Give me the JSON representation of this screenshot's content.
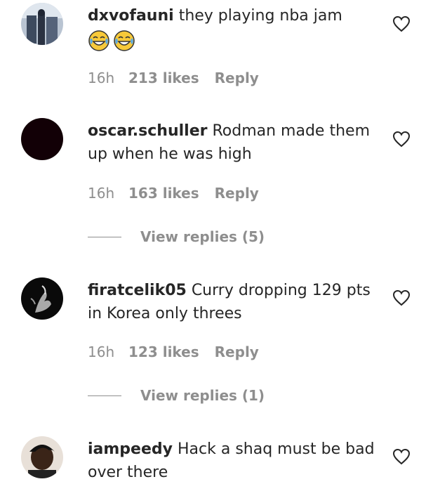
{
  "comments": [
    {
      "username": "dxvofauni",
      "text": "they playing nba jam",
      "emoji_line": [
        "face-with-tears-of-joy-icon",
        "face-with-tears-of-joy-icon"
      ],
      "time": "16h",
      "likes": "213 likes",
      "reply": "Reply"
    },
    {
      "username": "oscar.schuller",
      "text": "Rodman made them up when he was high",
      "time": "16h",
      "likes": "163 likes",
      "reply": "Reply",
      "view_replies": "View replies (5)"
    },
    {
      "username": "firatcelik05",
      "text": "Curry dropping 129 pts in Korea only threes",
      "time": "16h",
      "likes": "123 likes",
      "reply": "Reply",
      "view_replies": "View replies (1)"
    },
    {
      "username": "iampeedy",
      "text": "Hack a shaq must be bad over there"
    }
  ],
  "colors": {
    "text": "#262626",
    "muted": "#8e8e8e",
    "background": "#ffffff"
  }
}
